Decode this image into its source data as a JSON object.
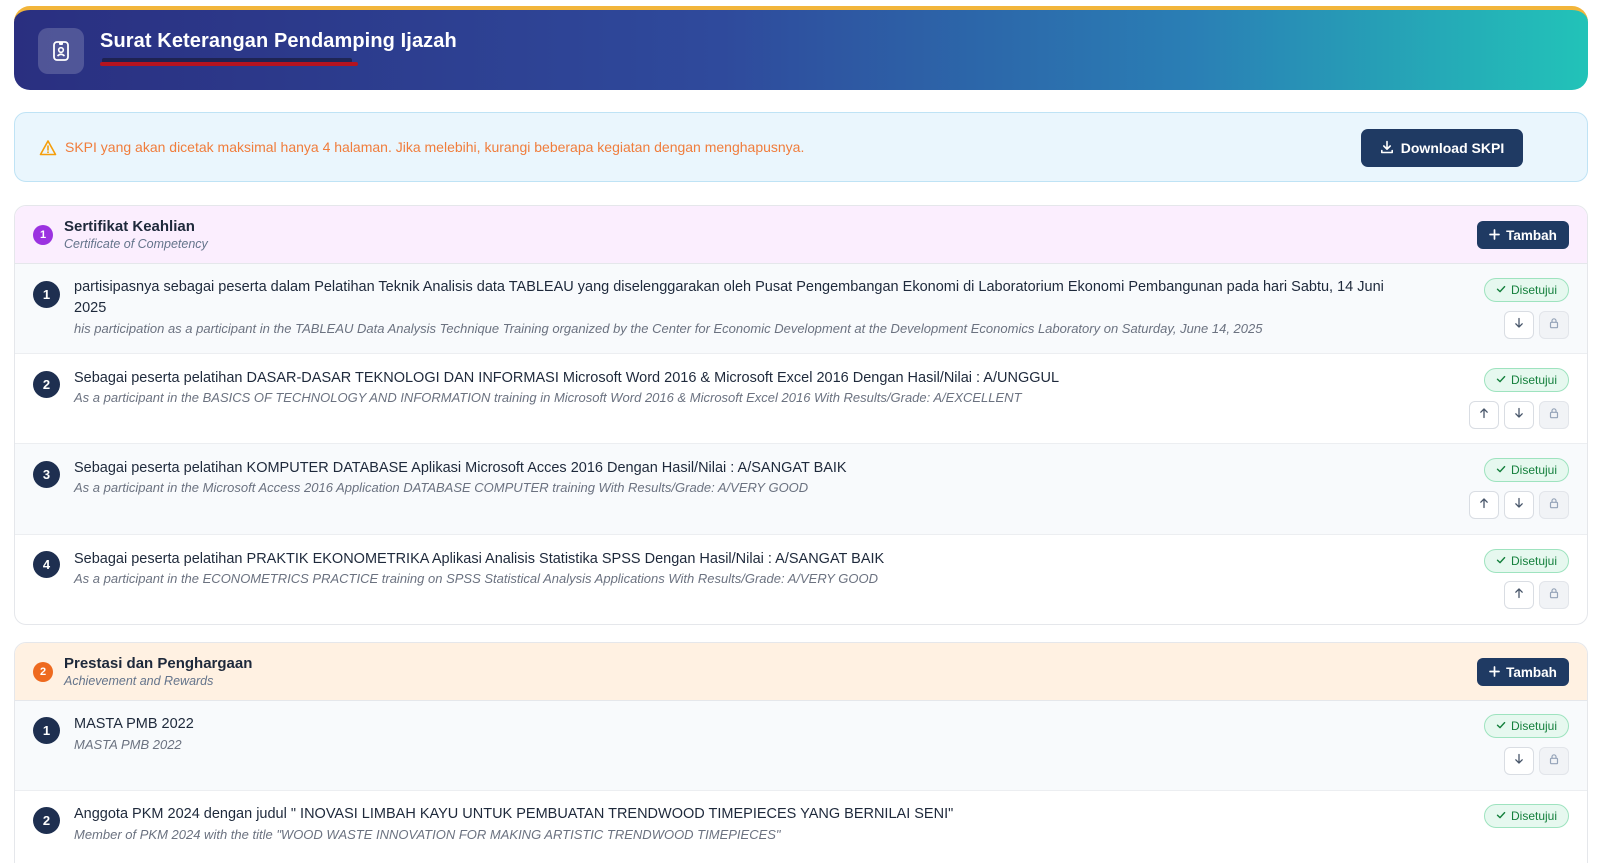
{
  "header": {
    "title": "Surat Keterangan Pendamping Ijazah",
    "icon": "id-badge-icon"
  },
  "notice": {
    "text": "SKPI yang akan dicetak maksimal hanya 4 halaman. Jika melebihi, kurangi beberapa kegiatan dengan menghapusnya.",
    "download_label": "Download SKPI",
    "color": "#f07d3c"
  },
  "sections": [
    {
      "number": "1",
      "title": "Sertifikat Keahlian",
      "subtitle": "Certificate of Competency",
      "add_label": "Tambah",
      "items": [
        {
          "number": "1",
          "title": "partisipasnya sebagai peserta dalam Pelatihan Teknik Analisis data TABLEAU yang diselenggarakan oleh Pusat Pengembangan Ekonomi di Laboratorium Ekonomi Pembangunan pada hari Sabtu, 14 Juni 2025",
          "subtitle": "his participation as a participant in the TABLEAU Data Analysis Technique Training organized by the Center for Economic Development at the Development Economics Laboratory on Saturday, June 14, 2025",
          "status": "Disetujui"
        },
        {
          "number": "2",
          "title": "Sebagai peserta pelatihan DASAR-DASAR TEKNOLOGI DAN INFORMASI Microsoft Word 2016 & Microsoft Excel 2016 Dengan Hasil/Nilai : A/UNGGUL",
          "subtitle": "As a participant in the BASICS OF TECHNOLOGY AND INFORMATION training in Microsoft Word 2016 & Microsoft Excel 2016 With Results/Grade: A/EXCELLENT",
          "status": "Disetujui"
        },
        {
          "number": "3",
          "title": "Sebagai peserta pelatihan KOMPUTER DATABASE Aplikasi Microsoft Acces 2016 Dengan Hasil/Nilai : A/SANGAT BAIK",
          "subtitle": "As a participant in the Microsoft Access 2016 Application DATABASE COMPUTER training With Results/Grade: A/VERY GOOD",
          "status": "Disetujui"
        },
        {
          "number": "4",
          "title": "Sebagai peserta pelatihan PRAKTIK EKONOMETRIKA Aplikasi Analisis Statistika SPSS Dengan Hasil/Nilai : A/SANGAT BAIK",
          "subtitle": "As a participant in the ECONOMETRICS PRACTICE training on SPSS Statistical Analysis Applications With Results/Grade: A/VERY GOOD",
          "status": "Disetujui"
        }
      ]
    },
    {
      "number": "2",
      "title": "Prestasi dan Penghargaan",
      "subtitle": "Achievement and Rewards",
      "add_label": "Tambah",
      "items": [
        {
          "number": "1",
          "title": "MASTA PMB 2022",
          "subtitle": "MASTA PMB 2022",
          "status": "Disetujui"
        },
        {
          "number": "2",
          "title": "Anggota PKM 2024 dengan judul \" INOVASI LIMBAH KAYU UNTUK PEMBUATAN TRENDWOOD TIMEPIECES YANG BERNILAI SENI\"",
          "subtitle": "Member of PKM 2024 with the title \"WOOD WASTE INNOVATION FOR MAKING ARTISTIC TRENDWOOD TIMEPIECES\"",
          "status": "Disetujui"
        }
      ]
    }
  ]
}
